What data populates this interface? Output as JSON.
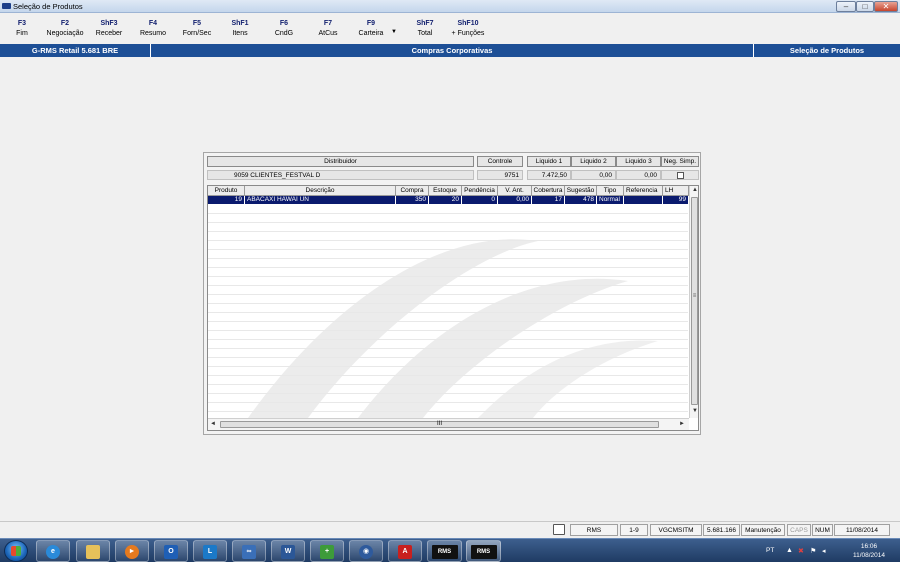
{
  "window": {
    "title": "Seleção de Produtos",
    "controls": {
      "minimize": "–",
      "maximize": "□",
      "close": "✕"
    }
  },
  "toolbar": {
    "keys": [
      {
        "key": "F3",
        "label": "Fim"
      },
      {
        "key": "F2",
        "label": "Negociação"
      },
      {
        "key": "ShF3",
        "label": "Receber"
      },
      {
        "key": "F4",
        "label": "Resumo"
      },
      {
        "key": "F5",
        "label": "Forn/Sec"
      },
      {
        "key": "ShF1",
        "label": "Itens"
      },
      {
        "key": "F6",
        "label": "CndG"
      },
      {
        "key": "F7",
        "label": "AtCus"
      },
      {
        "key": "F9",
        "label": "Carteira"
      },
      {
        "key": "ShF7",
        "label": "Total"
      },
      {
        "key": "ShF10",
        "label": "+ Funções"
      }
    ]
  },
  "band": {
    "version": "G-RMS Retail 5.681 BRE",
    "module": "Compras Corporativas",
    "screen": "Seleção de Produtos"
  },
  "summary": {
    "distribuidor_header": "Distribuidor",
    "distribuidor_value": "9059  CLIENTES_FESTVAL D",
    "controle_header": "Controle",
    "controle_value": "9751",
    "liquido1_header": "Liquido 1",
    "liquido1_value": "7.472,50",
    "liquido2_header": "Liquido 2",
    "liquido2_value": "0,00",
    "liquido3_header": "Liquido 3",
    "liquido3_value": "0,00",
    "negsimp_header": "Neg. Simp."
  },
  "grid": {
    "columns": [
      "Produto",
      "Descrição",
      "Compra",
      "Estoque",
      "Pendência",
      "V. Ant.",
      "Cobertura",
      "Sugestão",
      "Tipo",
      "Referencia",
      "LH"
    ],
    "rows": [
      {
        "produto": "19",
        "descricao": "ABACAXI HAWAI UN",
        "compra": "350",
        "estoque": "20",
        "pendencia": "0",
        "vant": "0,00",
        "cobertura": "17",
        "sugestao": "478",
        "tipo": "Normal",
        "referencia": "",
        "lh": "99"
      }
    ],
    "hscroll_grip": "III"
  },
  "statusbar": {
    "system": "RMS",
    "range": "1-9",
    "program": "VGCMSITM",
    "version": "5.681.166",
    "mode": "Manutenção",
    "caps": "CAPS",
    "num": "NUM",
    "date": "11/08/2014"
  },
  "taskbar": {
    "apps": [
      "Internet Explorer",
      "Windows Explorer",
      "Windows Media Player",
      "Outlook",
      "Lync",
      "Remote Desktop",
      "Word",
      "Installer",
      "Shield",
      "Acrobat",
      "RMS",
      "RMS"
    ],
    "rms_label": "RMS",
    "tray": {
      "lang": "PT",
      "time": "16:06",
      "date": "11/08/2014"
    }
  },
  "colors": {
    "band": "#1d4f96",
    "selected_row": "#0a1a6e",
    "function_key": "#12206f"
  }
}
